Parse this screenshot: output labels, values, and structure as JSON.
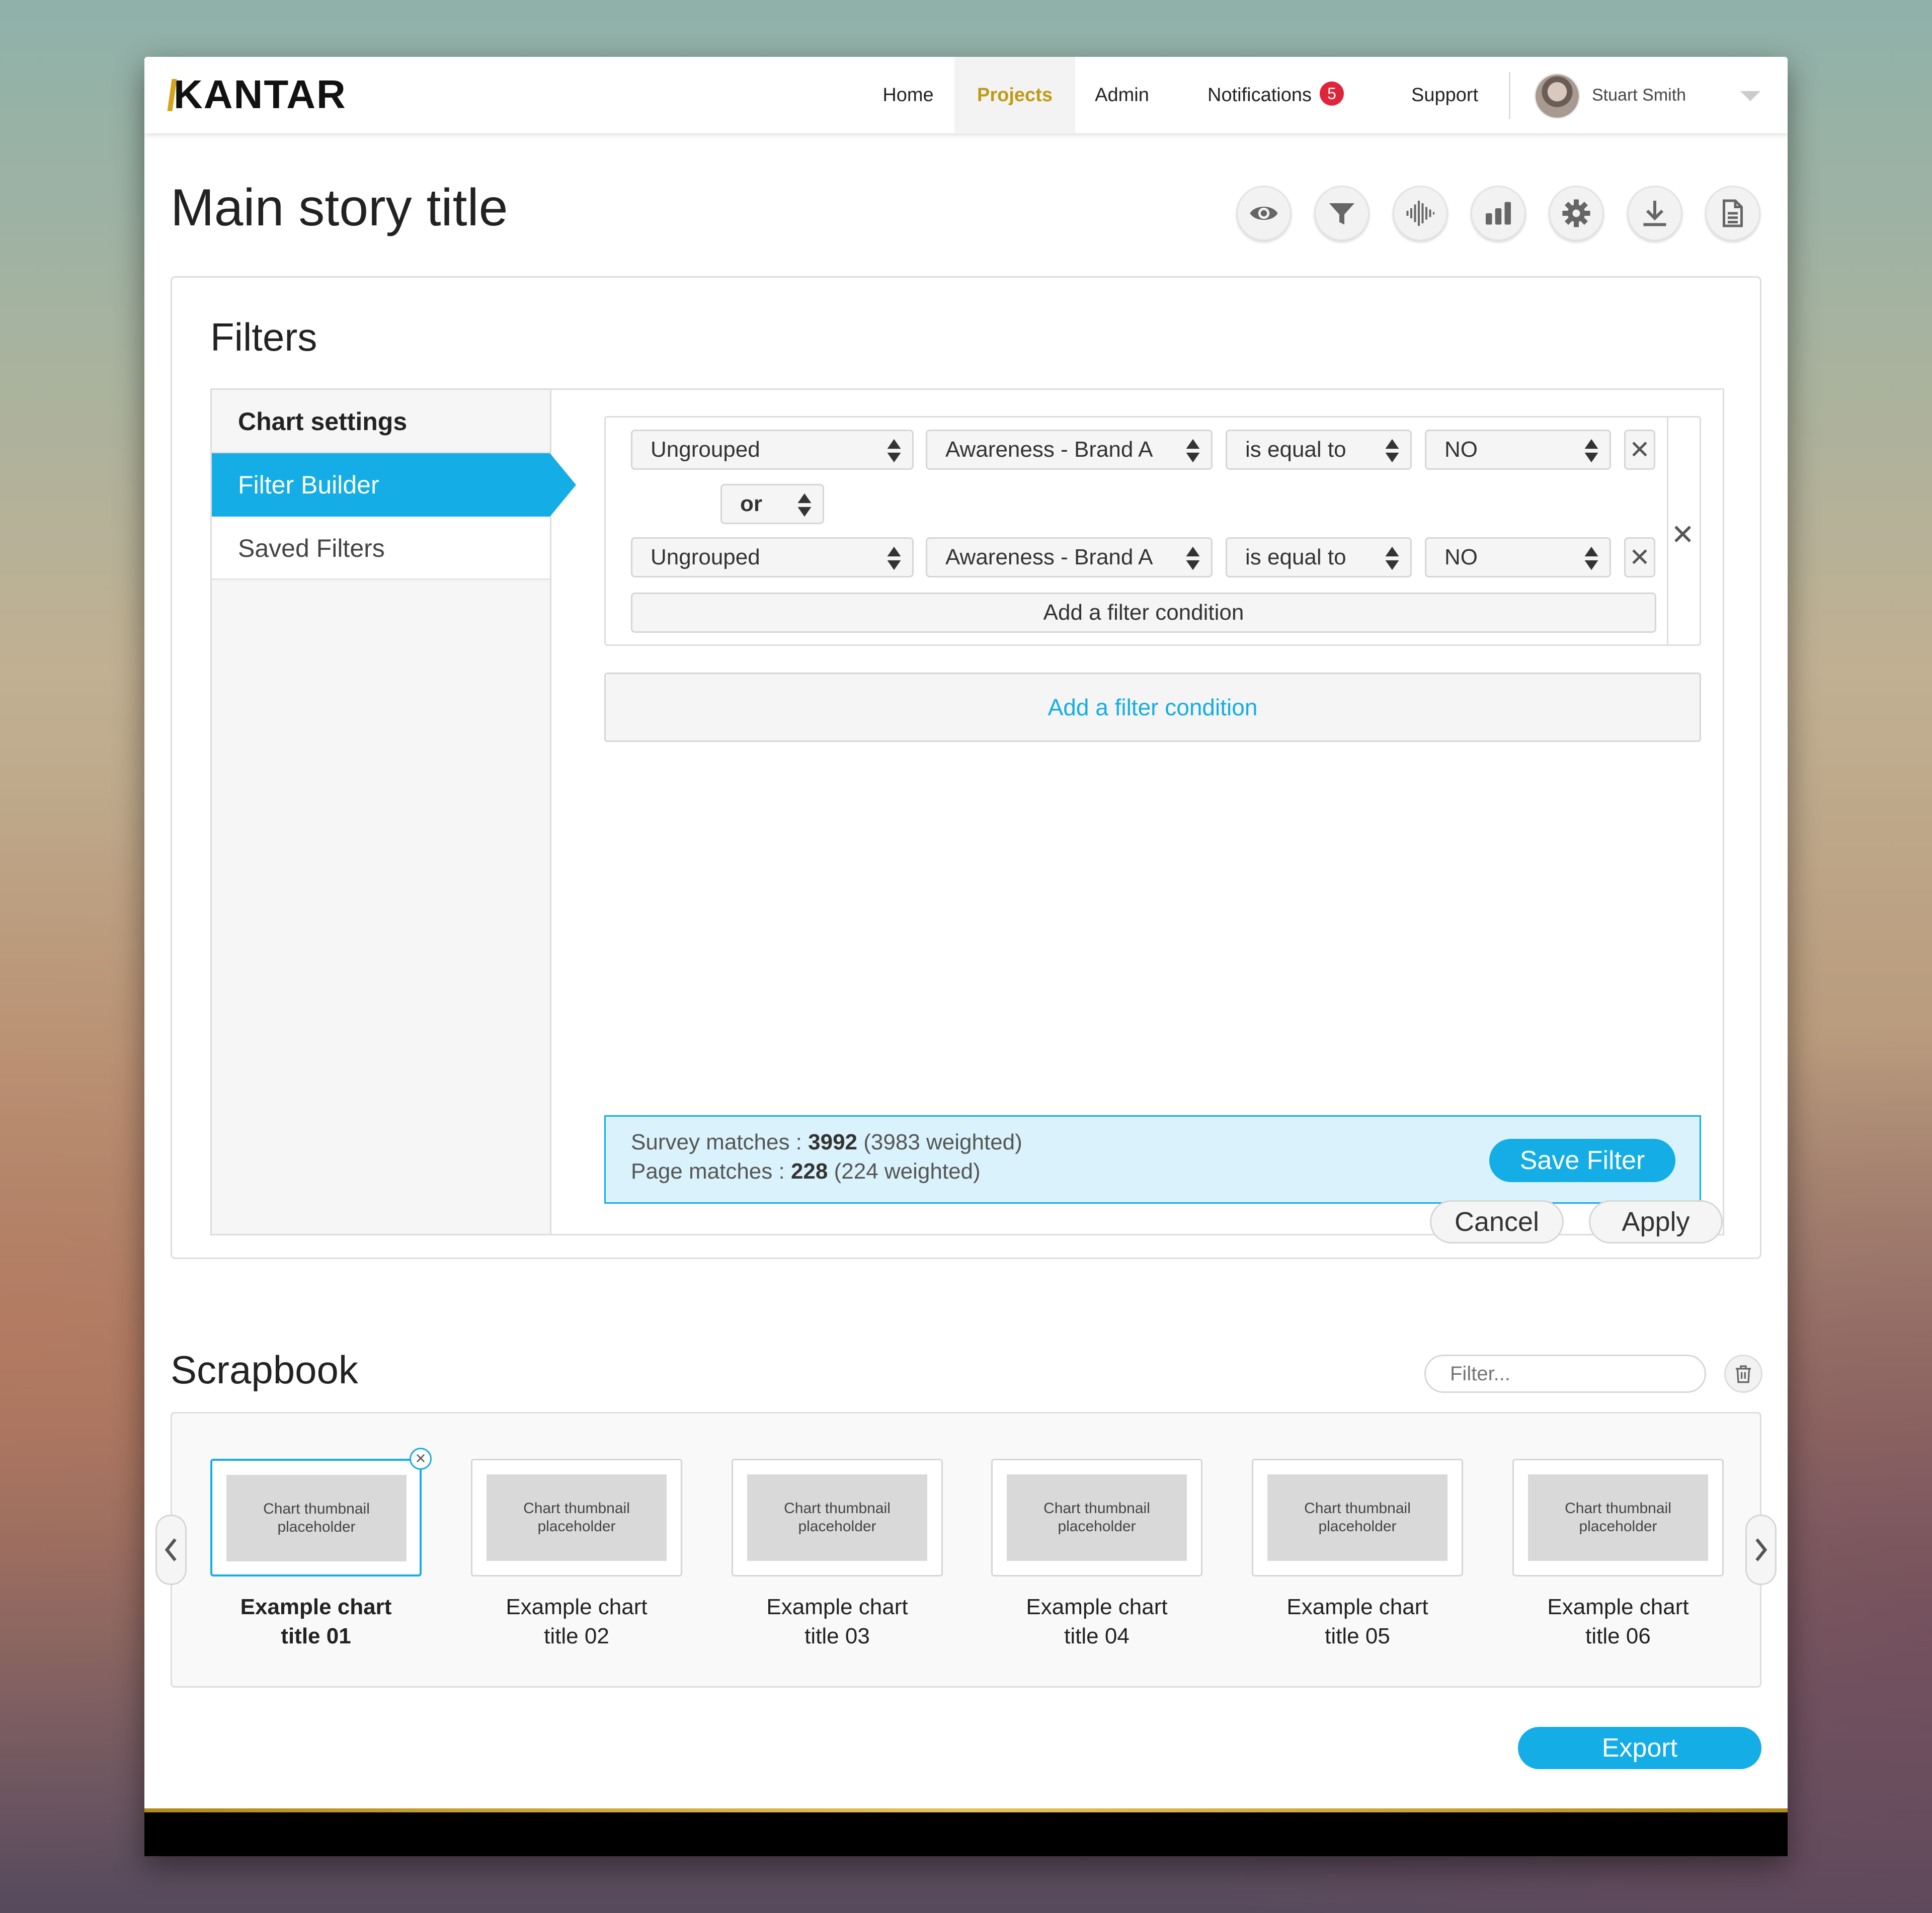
{
  "brand": {
    "logo": "KANTAR",
    "accent_color": "#14ade6",
    "gold_color": "#c09a12"
  },
  "nav": {
    "items": [
      "Home",
      "Projects",
      "Admin",
      "Notifications",
      "Support"
    ],
    "active": "Projects",
    "notifications_count": "5",
    "user_name": "Stuart Smith"
  },
  "page": {
    "title": "Main story title"
  },
  "toolbar": {
    "icons": [
      "eye-icon",
      "filter-icon",
      "waveform-icon",
      "bar-chart-icon",
      "gear-icon",
      "download-icon",
      "document-icon"
    ]
  },
  "filters": {
    "title": "Filters",
    "sidebar": {
      "header": "Chart settings",
      "items": [
        "Filter Builder",
        "Saved Filters"
      ],
      "active": "Filter Builder"
    },
    "rows": [
      {
        "group": "Ungrouped",
        "variable": "Awareness - Brand A",
        "operator": "is equal to",
        "value": "NO"
      },
      {
        "group": "Ungrouped",
        "variable": "Awareness - Brand A",
        "operator": "is equal to",
        "value": "NO"
      }
    ],
    "connector": "or",
    "add_condition_inner": "Add a filter condition",
    "add_condition_outer": "Add a filter condition",
    "matches": {
      "survey_label": "Survey matches : ",
      "survey_count": "3992",
      "survey_weighted": " (3983 weighted)",
      "page_label": "Page matches : ",
      "page_count": "228",
      "page_weighted": " (224 weighted)"
    },
    "save_filter": "Save Filter",
    "cancel": "Cancel",
    "apply": "Apply"
  },
  "scrapbook": {
    "title": "Scrapbook",
    "filter_placeholder": "Filter...",
    "thumbnails": [
      {
        "placeholder_l1": "Chart thumbnail",
        "placeholder_l2": "placeholder",
        "title_l1": "Example chart",
        "title_l2": "title 01"
      },
      {
        "placeholder_l1": "Chart thumbnail",
        "placeholder_l2": "placeholder",
        "title_l1": "Example chart",
        "title_l2": "title 02"
      },
      {
        "placeholder_l1": "Chart thumbnail",
        "placeholder_l2": "placeholder",
        "title_l1": "Example chart",
        "title_l2": "title 03"
      },
      {
        "placeholder_l1": "Chart thumbnail",
        "placeholder_l2": "placeholder",
        "title_l1": "Example chart",
        "title_l2": "title 04"
      },
      {
        "placeholder_l1": "Chart thumbnail",
        "placeholder_l2": "placeholder",
        "title_l1": "Example chart",
        "title_l2": "title 05"
      },
      {
        "placeholder_l1": "Chart thumbnail",
        "placeholder_l2": "placeholder",
        "title_l1": "Example chart",
        "title_l2": "title 06"
      }
    ],
    "export": "Export"
  }
}
